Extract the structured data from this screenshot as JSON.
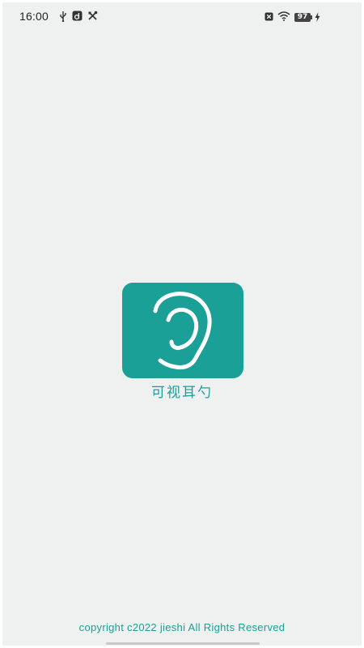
{
  "status_bar": {
    "time": "16:00",
    "battery": "97",
    "left_icons": [
      "usb-icon",
      "notification-icon",
      "tools-icon"
    ],
    "right_icons": [
      "sim-icon",
      "wifi-icon",
      "battery-icon",
      "charging-icon"
    ]
  },
  "app": {
    "name": "可视耳勺",
    "logo_icon": "ear-icon",
    "brand_color": "#1ba097"
  },
  "footer": {
    "copyright": "copyright c2022 jieshi All Rights Reserved"
  }
}
